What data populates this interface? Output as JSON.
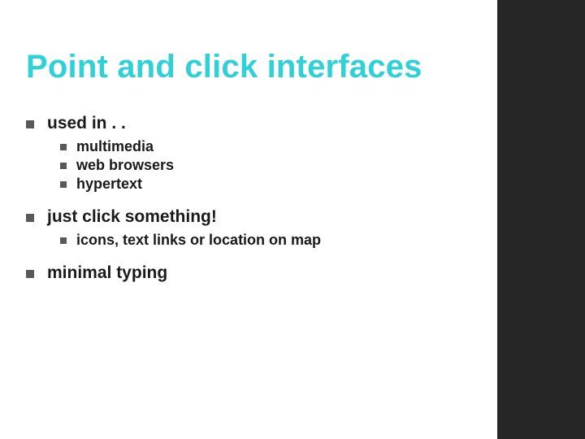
{
  "title": "Point and click interfaces",
  "bullets": [
    {
      "text": "used in . .",
      "children": [
        {
          "text": "multimedia"
        },
        {
          "text": "web browsers"
        },
        {
          "text": "hypertext"
        }
      ]
    },
    {
      "text": "just click something!",
      "children": [
        {
          "text": "icons, text links or location on map"
        }
      ]
    },
    {
      "text": "minimal typing",
      "children": []
    }
  ]
}
